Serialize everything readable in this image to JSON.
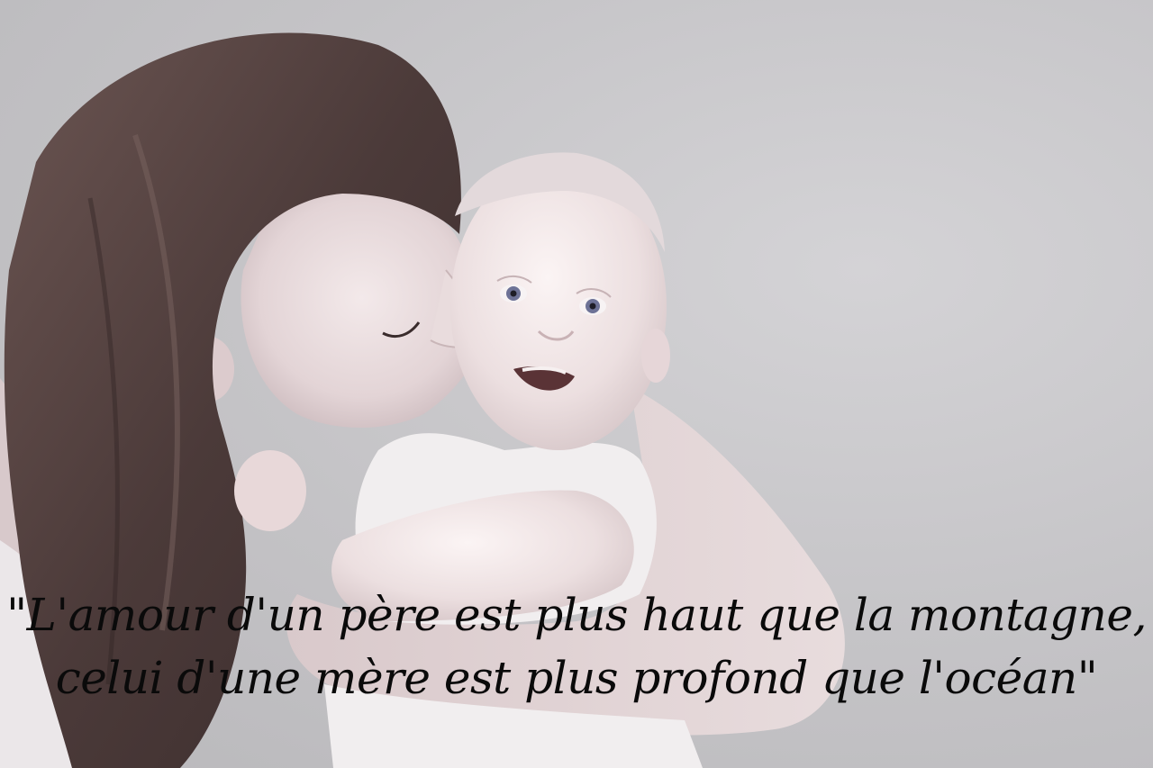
{
  "quote": {
    "line1": "\"L'amour d'un père est plus haut que la montagne,",
    "line2": "celui d'une mère est plus profond que l'océan\""
  },
  "colors": {
    "background": "#c4c3c6",
    "text": "#0a0a0a",
    "hair": "#4a3a38",
    "skin": "#e6d8da",
    "clothing": "#efecee"
  }
}
